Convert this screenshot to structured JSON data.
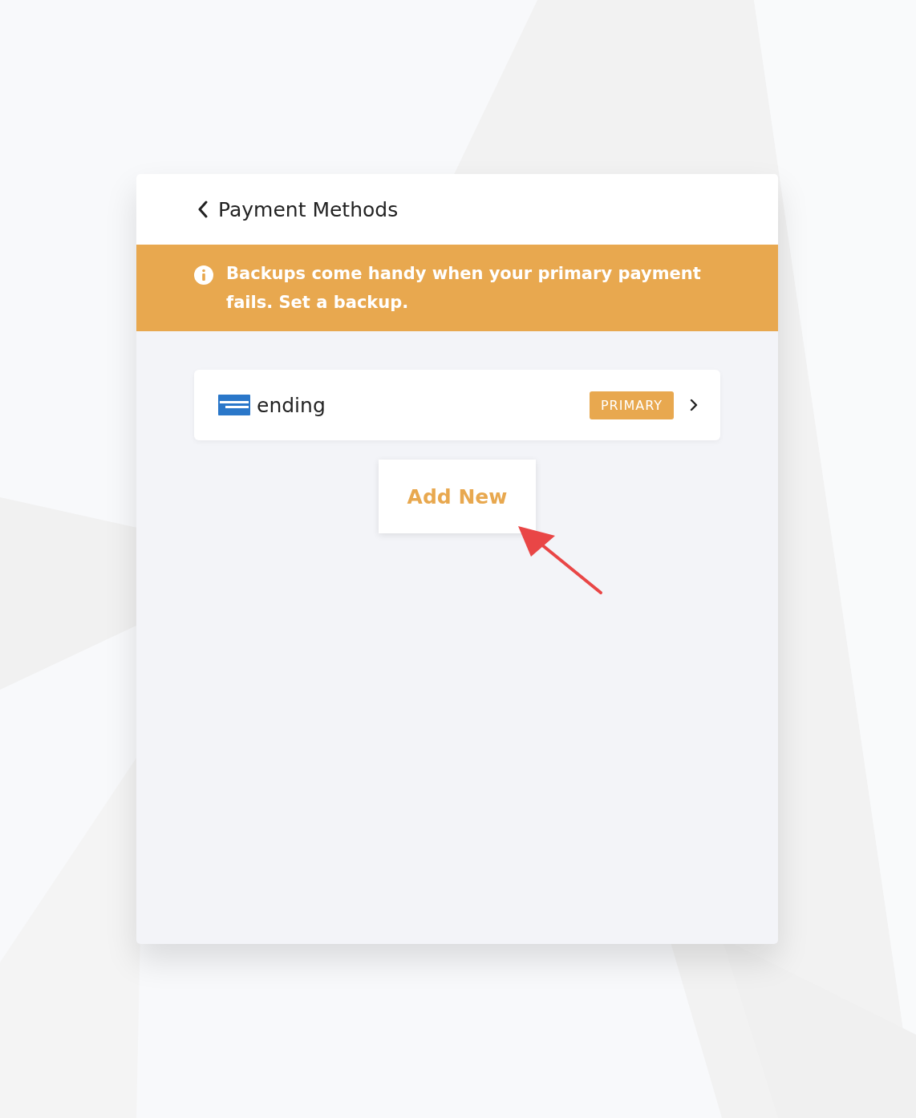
{
  "header": {
    "title": "Payment Methods"
  },
  "banner": {
    "message": "Backups come handy when your primary payment fails. Set a backup."
  },
  "payment_methods": [
    {
      "label": "ending",
      "badge": "PRIMARY"
    }
  ],
  "add_button": {
    "label": "Add New"
  }
}
